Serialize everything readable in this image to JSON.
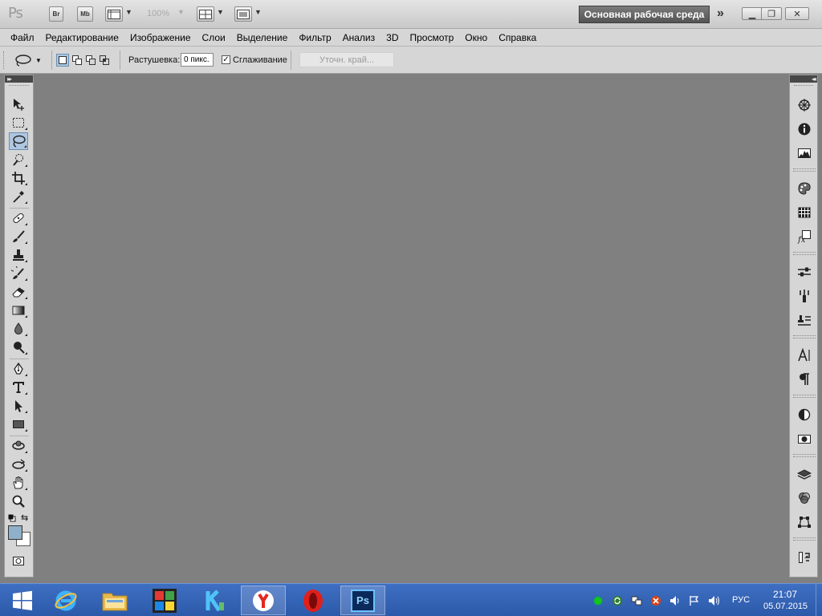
{
  "appbar": {
    "logo": "Ps",
    "bridge": "Br",
    "mini_bridge": "Mb",
    "zoom": "100%",
    "workspace": "Основная рабочая среда",
    "more": "»"
  },
  "menu": [
    "Файл",
    "Редактирование",
    "Изображение",
    "Слои",
    "Выделение",
    "Фильтр",
    "Анализ",
    "3D",
    "Просмотр",
    "Окно",
    "Справка"
  ],
  "options": {
    "feather_label": "Растушевка:",
    "feather_value": "0 пикс.",
    "antialias_label": "Сглаживание",
    "antialias_checked": true,
    "refine_edge": "Уточн. край..."
  },
  "toolbar": {
    "active_tool": "lasso-tool",
    "foreground_color": "#8fb0c8",
    "background_color": "#ffffff"
  },
  "taskbar": {
    "language": "РУС",
    "time": "21:07",
    "date": "05.07.2015",
    "ps_label": "Ps"
  }
}
